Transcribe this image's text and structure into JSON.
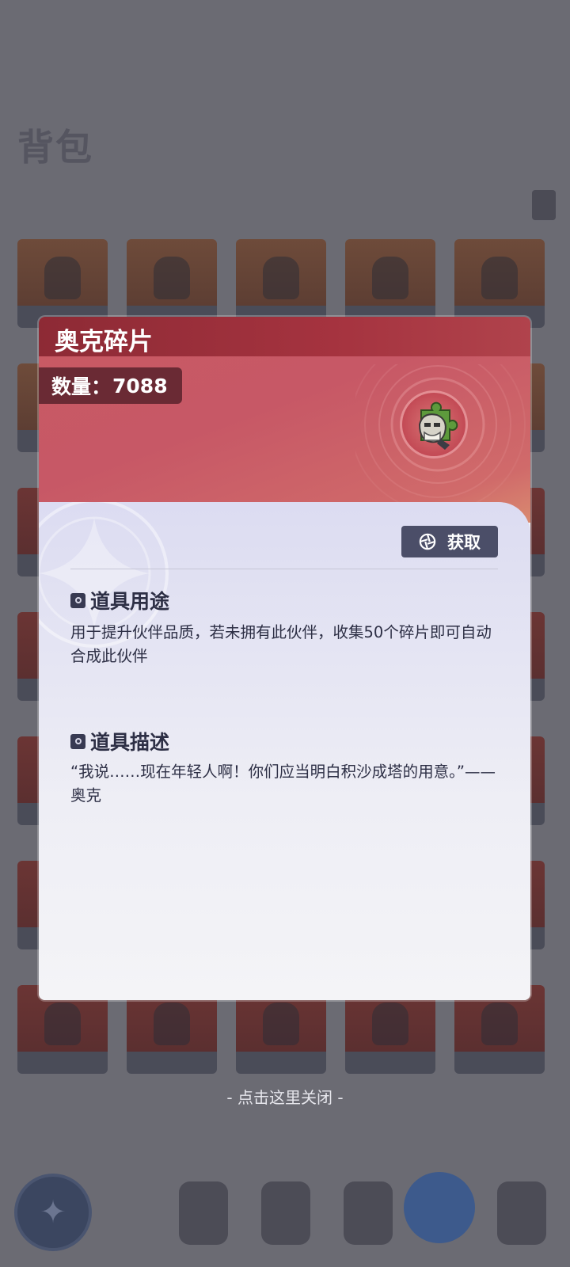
{
  "background": {
    "title": "背包",
    "rows": 7,
    "cols": 5
  },
  "modal": {
    "title": "奥克碎片",
    "quantity_label": "数量：",
    "quantity_value": "7088",
    "obtain_label": "获取",
    "sections": [
      {
        "heading": "道具用途",
        "text": "用于提升伙伴品质，若未拥有此伙伴，收集50个碎片即可自动合成此伙伴"
      },
      {
        "heading": "道具描述",
        "text": "“我说……现在年轻人啊！你们应当明白积沙成塔的用意。”——奥克"
      }
    ]
  },
  "close_hint": "- 点击这里关闭 -",
  "colors": {
    "header_red": "#c85a63",
    "title_bar": "#8d2a35",
    "button_bg": "#4b4e68",
    "text_dark": "#2d2f45"
  },
  "icons": {
    "item": "puzzle-fragment-icon",
    "obtain": "aperture-icon",
    "bullet": "section-bullet-icon"
  }
}
